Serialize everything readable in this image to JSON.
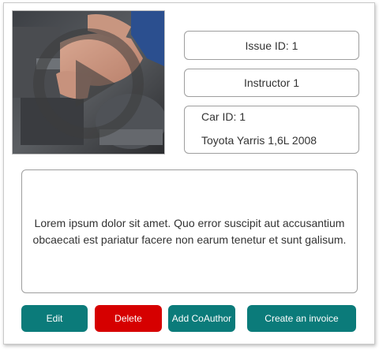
{
  "issue": {
    "id_label": "Issue ID: 1"
  },
  "instructor": {
    "label": "Instructor 1"
  },
  "car": {
    "id_label": "Car ID: 1",
    "model": "Toyota Yarris 1,6L 2008"
  },
  "description": {
    "text": "Lorem ipsum dolor sit amet. Quo error suscipit aut accusantium obcaecati est pariatur facere non earum tenetur et sunt galisum."
  },
  "actions": {
    "edit": "Edit",
    "delete": "Delete",
    "add_coauthor": "Add CoAuthor",
    "create_invoice": "Create an invoice"
  },
  "video": {
    "icon": "play-icon"
  },
  "colors": {
    "primary": "#0b7b7a",
    "danger": "#d60000",
    "border": "#9e9e9e"
  }
}
